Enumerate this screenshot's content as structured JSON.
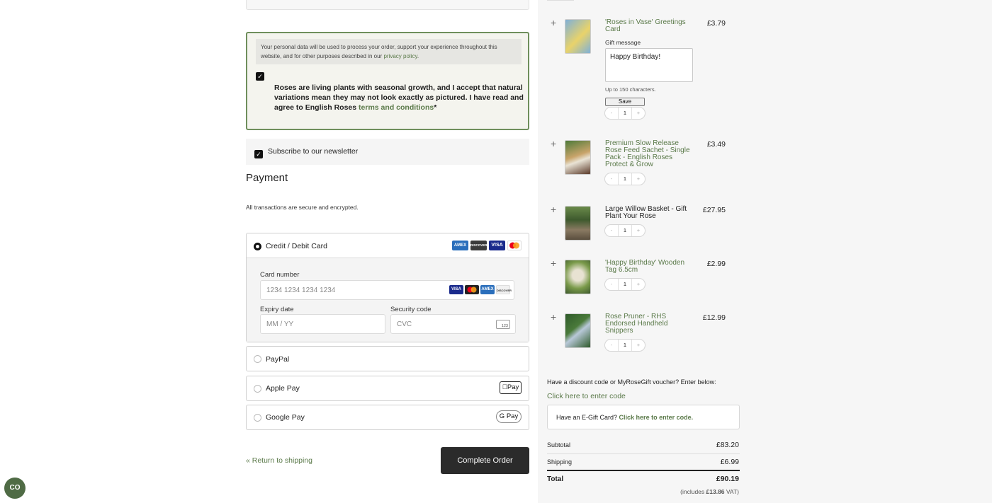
{
  "terms": {
    "privacy_text": "Your personal data will be used to process your order, support your experience throughout this website, and for other purposes described in our ",
    "privacy_link": "privacy policy",
    "privacy_end": ".",
    "agree_text": "Roses are living plants with seasonal growth, and I accept that natural variations mean they may not look exactly as pictured. I have read and agree to English Roses ",
    "agree_link": "terms and conditions",
    "agree_required": "*"
  },
  "newsletter": {
    "label": "Subscribe to our newsletter",
    "checked": true
  },
  "payment": {
    "title": "Payment",
    "secure_note": "All transactions are secure and encrypted.",
    "methods": [
      {
        "label": "Credit / Debit Card",
        "selected": true
      },
      {
        "label": "PayPal",
        "selected": false
      },
      {
        "label": "Apple Pay",
        "selected": false,
        "badge": "Pay"
      },
      {
        "label": "Google Pay",
        "selected": false,
        "badge": "G Pay"
      }
    ],
    "card_brands_header": [
      "AMEX",
      "DISCOVER",
      "VISA",
      "MC"
    ],
    "card_brands_field": [
      "VISA",
      "MC",
      "AMEX",
      "DISCOVER"
    ],
    "card_number": {
      "label": "Card number",
      "placeholder": "1234 1234 1234 1234"
    },
    "expiry": {
      "label": "Expiry date",
      "placeholder": "MM / YY"
    },
    "cvc": {
      "label": "Security code",
      "placeholder": "CVC",
      "icon_text": "123"
    }
  },
  "footer": {
    "return_link": "« Return to shipping",
    "complete_button": "Complete Order",
    "chat_icon_text": "CO"
  },
  "cart": {
    "items": [
      {
        "name": "'Roses in Vase' Greetings Card",
        "price": "£3.79",
        "qty": "1",
        "linked": true
      },
      {
        "name": "Premium Slow Release Rose Feed Sachet - Single Pack - English Roses Protect & Grow",
        "price": "£3.49",
        "qty": "1",
        "linked": true
      },
      {
        "name": "Large Willow Basket - Gift Plant Your Rose",
        "price": "£27.95",
        "qty": "1",
        "linked": false
      },
      {
        "name": "'Happy Birthday' Wooden Tag 6.5cm",
        "price": "£2.99",
        "qty": "1",
        "linked": true
      },
      {
        "name": "Rose Pruner - RHS Endorsed Handheld Snippers",
        "price": "£12.99",
        "qty": "1",
        "linked": true
      }
    ],
    "gift": {
      "label": "Gift message",
      "value": "Happy Birthday!",
      "help": "Up to 150 characters.",
      "save": "Save"
    },
    "qty_minus": "-",
    "qty_plus": "+"
  },
  "discount": {
    "title": "Have a discount code or MyRoseGift voucher? Enter below:",
    "link": "Click here to enter code",
    "egift_text": "Have an E-Gift Card? ",
    "egift_link": "Click here to enter code."
  },
  "summary": {
    "subtotal_label": "Subtotal",
    "subtotal": "£83.20",
    "shipping_label": "Shipping",
    "shipping": "£6.99",
    "total_label": "Total",
    "total": "£90.19",
    "vat_prefix": "(includes ",
    "vat_amount": "£13.86",
    "vat_suffix": " VAT)"
  },
  "colors": {
    "accent_green": "#5b7a4a",
    "dark_button": "#2b2b2b"
  }
}
